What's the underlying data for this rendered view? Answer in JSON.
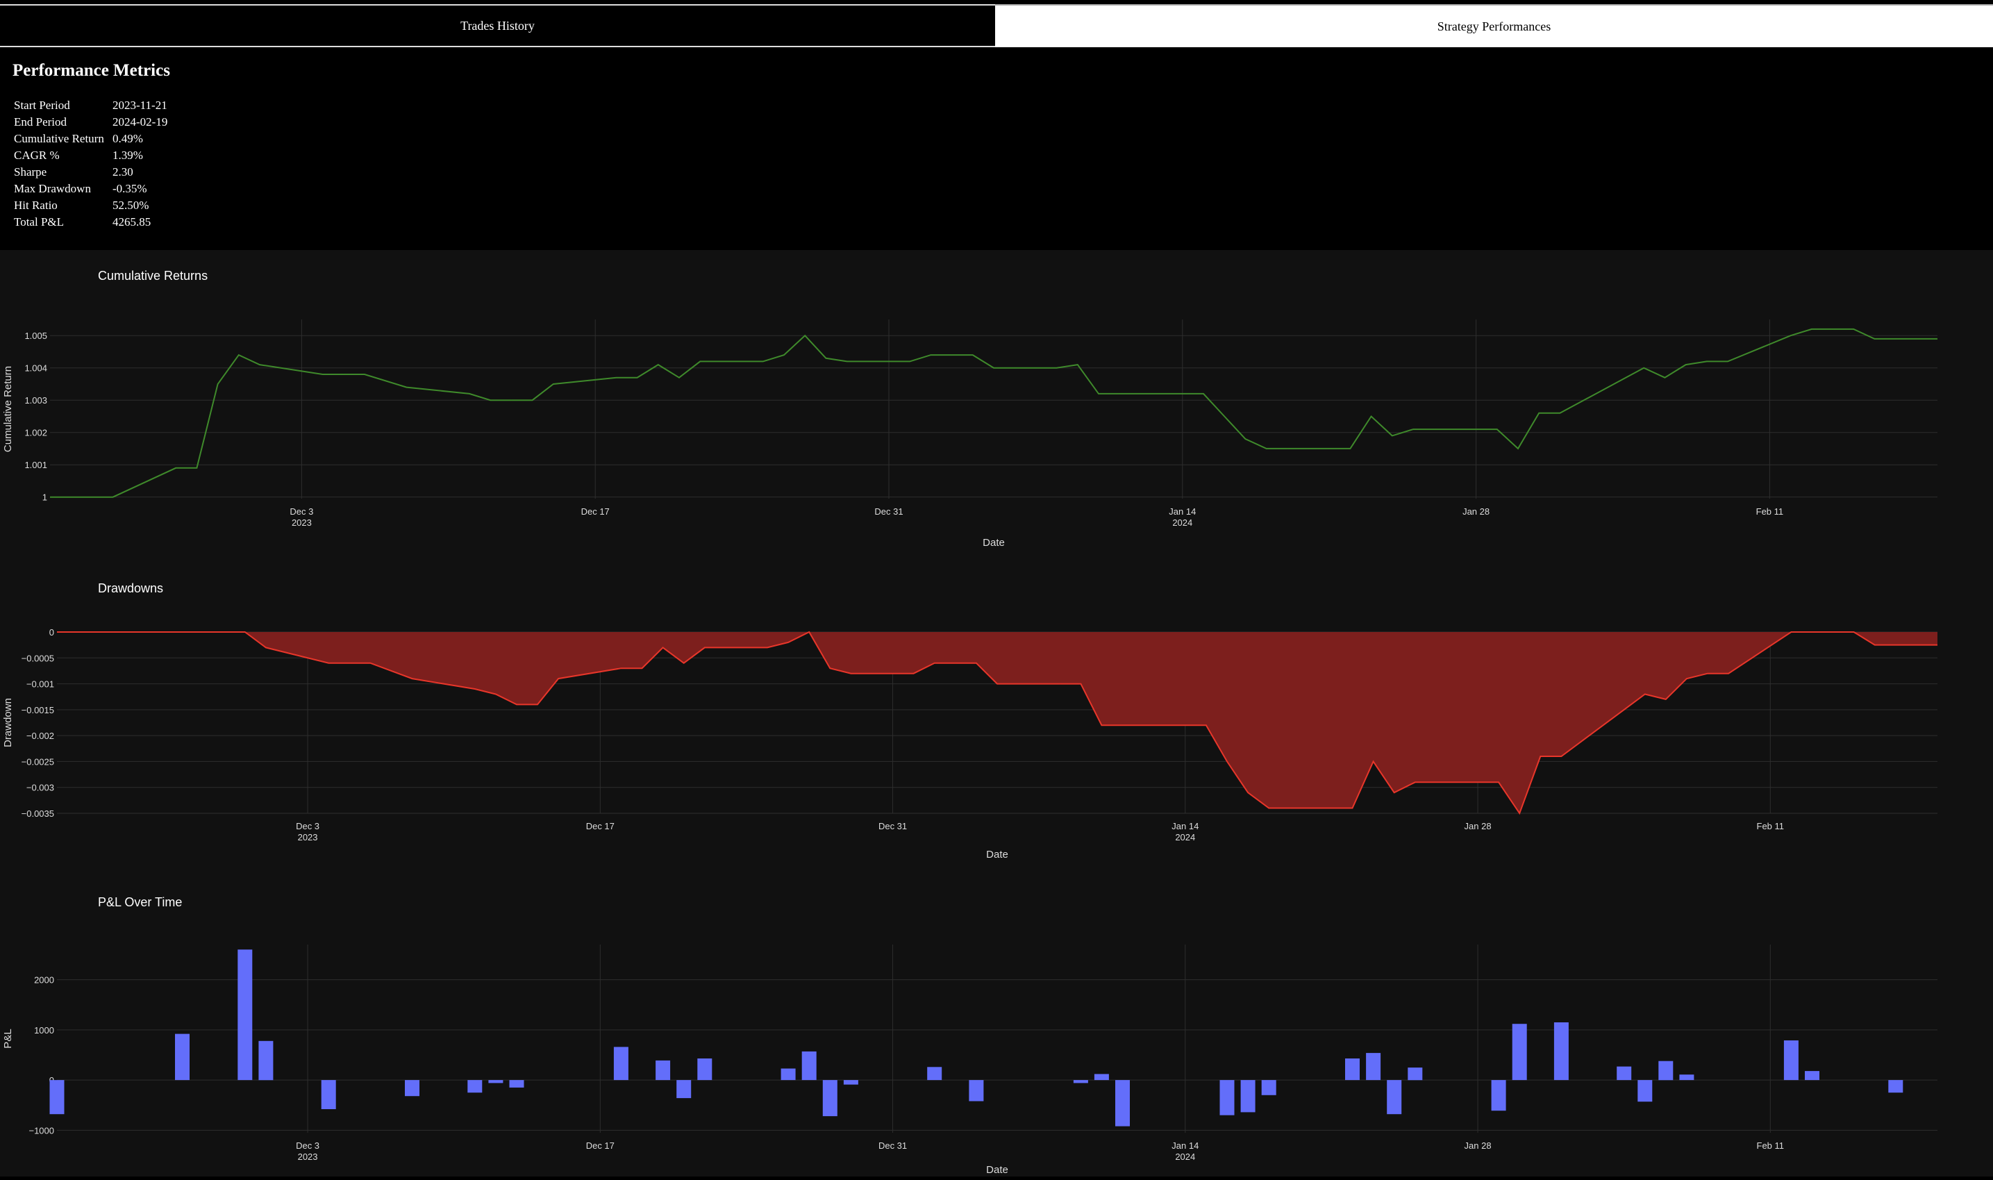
{
  "tabs": {
    "trades_history": "Trades History",
    "strategy_performances": "Strategy Performances"
  },
  "metrics": {
    "title": "Performance Metrics",
    "rows": [
      {
        "label": "Start Period",
        "value": "2023-11-21"
      },
      {
        "label": "End Period",
        "value": "2024-02-19"
      },
      {
        "label": "Cumulative Return",
        "value": "0.49%"
      },
      {
        "label": "CAGR %",
        "value": "1.39%"
      },
      {
        "label": "Sharpe",
        "value": "2.30"
      },
      {
        "label": "Max Drawdown",
        "value": "-0.35%"
      },
      {
        "label": "Hit Ratio",
        "value": "52.50%"
      },
      {
        "label": "Total P&L",
        "value": "4265.85"
      }
    ]
  },
  "chart_data": [
    {
      "type": "line",
      "title": "Cumulative Returns",
      "xlabel": "Date",
      "ylabel": "Cumulative Return",
      "color": "#3f8a2b",
      "grid": true,
      "xrange": [
        "2023-11-21",
        "2024-02-19"
      ],
      "ylim": [
        0.99995,
        1.0055
      ],
      "xticks": [
        [
          "2023-12-03",
          "Dec 3",
          "2023"
        ],
        [
          "2023-12-17",
          "Dec 17",
          ""
        ],
        [
          "2023-12-31",
          "Dec 31",
          ""
        ],
        [
          "2024-01-14",
          "Jan 14",
          "2024"
        ],
        [
          "2024-01-28",
          "Jan 28",
          ""
        ],
        [
          "2024-02-11",
          "Feb 11",
          ""
        ]
      ],
      "yticks": [
        [
          1.0,
          "1"
        ],
        [
          1.001,
          "1.001"
        ],
        [
          1.002,
          "1.002"
        ],
        [
          1.003,
          "1.003"
        ],
        [
          1.004,
          "1.004"
        ],
        [
          1.005,
          "1.005"
        ]
      ],
      "x": [
        "2023-11-21",
        "2023-11-24",
        "2023-11-27",
        "2023-11-28",
        "2023-11-29",
        "2023-11-30",
        "2023-12-01",
        "2023-12-04",
        "2023-12-05",
        "2023-12-06",
        "2023-12-08",
        "2023-12-11",
        "2023-12-12",
        "2023-12-13",
        "2023-12-14",
        "2023-12-15",
        "2023-12-18",
        "2023-12-19",
        "2023-12-20",
        "2023-12-21",
        "2023-12-22",
        "2023-12-25",
        "2023-12-26",
        "2023-12-27",
        "2023-12-28",
        "2023-12-29",
        "2024-01-01",
        "2024-01-02",
        "2024-01-03",
        "2024-01-04",
        "2024-01-05",
        "2024-01-08",
        "2024-01-09",
        "2024-01-10",
        "2024-01-11",
        "2024-01-15",
        "2024-01-16",
        "2024-01-17",
        "2024-01-18",
        "2024-01-19",
        "2024-01-22",
        "2024-01-23",
        "2024-01-24",
        "2024-01-25",
        "2024-01-26",
        "2024-01-29",
        "2024-01-30",
        "2024-01-31",
        "2024-02-01",
        "2024-02-05",
        "2024-02-06",
        "2024-02-07",
        "2024-02-08",
        "2024-02-09",
        "2024-02-12",
        "2024-02-13",
        "2024-02-14",
        "2024-02-15",
        "2024-02-16",
        "2024-02-19"
      ],
      "y": [
        1.0,
        1.0,
        1.0009,
        1.0009,
        1.0035,
        1.0044,
        1.0041,
        1.0038,
        1.0038,
        1.0038,
        1.0034,
        1.0032,
        1.003,
        1.003,
        1.003,
        1.0035,
        1.0037,
        1.0037,
        1.0041,
        1.0037,
        1.0042,
        1.0042,
        1.0044,
        1.005,
        1.0043,
        1.0042,
        1.0042,
        1.0044,
        1.0044,
        1.0044,
        1.004,
        1.004,
        1.0041,
        1.0032,
        1.0032,
        1.0032,
        1.0025,
        1.0018,
        1.0015,
        1.0015,
        1.0015,
        1.0025,
        1.0019,
        1.0021,
        1.0021,
        1.0021,
        1.0015,
        1.0026,
        1.0026,
        1.004,
        1.0037,
        1.0041,
        1.0042,
        1.0042,
        1.005,
        1.0052,
        1.0052,
        1.0052,
        1.0049,
        1.0049
      ]
    },
    {
      "type": "area",
      "title": "Drawdowns",
      "xlabel": "Date",
      "ylabel": "Drawdown",
      "color": "#e8362a",
      "fill": "#7d1f1d",
      "grid": true,
      "xrange": [
        "2023-11-21",
        "2024-02-19"
      ],
      "ylim": [
        -0.0035,
        0.0
      ],
      "xticks": [
        [
          "2023-12-03",
          "Dec 3",
          "2023"
        ],
        [
          "2023-12-17",
          "Dec 17",
          ""
        ],
        [
          "2023-12-31",
          "Dec 31",
          ""
        ],
        [
          "2024-01-14",
          "Jan 14",
          "2024"
        ],
        [
          "2024-01-28",
          "Jan 28",
          ""
        ],
        [
          "2024-02-11",
          "Feb 11",
          ""
        ]
      ],
      "yticks": [
        [
          0.0,
          "0"
        ],
        [
          -0.0005,
          "−0.0005"
        ],
        [
          -0.001,
          "−0.001"
        ],
        [
          -0.0015,
          "−0.0015"
        ],
        [
          -0.002,
          "−0.002"
        ],
        [
          -0.0025,
          "−0.0025"
        ],
        [
          -0.003,
          "−0.003"
        ],
        [
          -0.0035,
          "−0.0035"
        ]
      ],
      "x": [
        "2023-11-21",
        "2023-11-24",
        "2023-11-27",
        "2023-11-28",
        "2023-11-29",
        "2023-11-30",
        "2023-12-01",
        "2023-12-04",
        "2023-12-05",
        "2023-12-06",
        "2023-12-08",
        "2023-12-11",
        "2023-12-12",
        "2023-12-13",
        "2023-12-14",
        "2023-12-15",
        "2023-12-18",
        "2023-12-19",
        "2023-12-20",
        "2023-12-21",
        "2023-12-22",
        "2023-12-25",
        "2023-12-26",
        "2023-12-27",
        "2023-12-28",
        "2023-12-29",
        "2024-01-01",
        "2024-01-02",
        "2024-01-03",
        "2024-01-04",
        "2024-01-05",
        "2024-01-08",
        "2024-01-09",
        "2024-01-10",
        "2024-01-11",
        "2024-01-15",
        "2024-01-16",
        "2024-01-17",
        "2024-01-18",
        "2024-01-19",
        "2024-01-22",
        "2024-01-23",
        "2024-01-24",
        "2024-01-25",
        "2024-01-26",
        "2024-01-29",
        "2024-01-30",
        "2024-01-31",
        "2024-02-01",
        "2024-02-05",
        "2024-02-06",
        "2024-02-07",
        "2024-02-08",
        "2024-02-09",
        "2024-02-12",
        "2024-02-13",
        "2024-02-14",
        "2024-02-15",
        "2024-02-16",
        "2024-02-19"
      ],
      "y": [
        0,
        0,
        0,
        0,
        0,
        0,
        -0.0003,
        -0.0006,
        -0.0006,
        -0.0006,
        -0.0009,
        -0.0011,
        -0.0012,
        -0.0014,
        -0.0014,
        -0.0009,
        -0.0007,
        -0.0007,
        -0.0003,
        -0.0006,
        -0.0003,
        -0.0003,
        -0.0002,
        0,
        -0.0007,
        -0.0008,
        -0.0008,
        -0.0006,
        -0.0006,
        -0.0006,
        -0.001,
        -0.001,
        -0.001,
        -0.0018,
        -0.0018,
        -0.0018,
        -0.0025,
        -0.0031,
        -0.0034,
        -0.0034,
        -0.0034,
        -0.0025,
        -0.0031,
        -0.0029,
        -0.0029,
        -0.0029,
        -0.0035,
        -0.0024,
        -0.0024,
        -0.0012,
        -0.0013,
        -0.0009,
        -0.0008,
        -0.0008,
        0,
        0,
        0,
        0,
        -0.00025,
        -0.00025
      ]
    },
    {
      "type": "bar",
      "title": "P&L Over Time",
      "xlabel": "Date",
      "ylabel": "P&L",
      "color": "#636efa",
      "grid": true,
      "xrange": [
        "2023-11-21",
        "2024-02-19"
      ],
      "ylim": [
        -1050,
        2700
      ],
      "xticks": [
        [
          "2023-12-03",
          "Dec 3",
          "2023"
        ],
        [
          "2023-12-17",
          "Dec 17",
          ""
        ],
        [
          "2023-12-31",
          "Dec 31",
          ""
        ],
        [
          "2024-01-14",
          "Jan 14",
          "2024"
        ],
        [
          "2024-01-28",
          "Jan 28",
          ""
        ],
        [
          "2024-02-11",
          "Feb 11",
          ""
        ]
      ],
      "yticks": [
        [
          -1000,
          "−1000"
        ],
        [
          0,
          "0"
        ],
        [
          1000,
          "1000"
        ],
        [
          2000,
          "2000"
        ]
      ],
      "x": [
        "2023-11-21",
        "2023-11-27",
        "2023-11-30",
        "2023-12-01",
        "2023-12-04",
        "2023-12-08",
        "2023-12-11",
        "2023-12-12",
        "2023-12-13",
        "2023-12-18",
        "2023-12-20",
        "2023-12-21",
        "2023-12-22",
        "2023-12-26",
        "2023-12-27",
        "2023-12-28",
        "2023-12-29",
        "2024-01-02",
        "2024-01-04",
        "2024-01-09",
        "2024-01-10",
        "2024-01-11",
        "2024-01-16",
        "2024-01-17",
        "2024-01-18",
        "2024-01-22",
        "2024-01-23",
        "2024-01-24",
        "2024-01-25",
        "2024-01-29",
        "2024-01-30",
        "2024-02-01",
        "2024-02-04",
        "2024-02-05",
        "2024-02-06",
        "2024-02-07",
        "2024-02-12",
        "2024-02-13",
        "2024-02-17"
      ],
      "values": [
        -680,
        920,
        2600,
        780,
        -580,
        -320,
        -250,
        -60,
        -150,
        660,
        390,
        -360,
        430,
        230,
        570,
        -720,
        -90,
        260,
        -420,
        -60,
        120,
        -920,
        -700,
        -640,
        -300,
        430,
        540,
        -680,
        250,
        -610,
        1120,
        1150,
        270,
        -430,
        380,
        110,
        790,
        180,
        -250
      ]
    }
  ]
}
